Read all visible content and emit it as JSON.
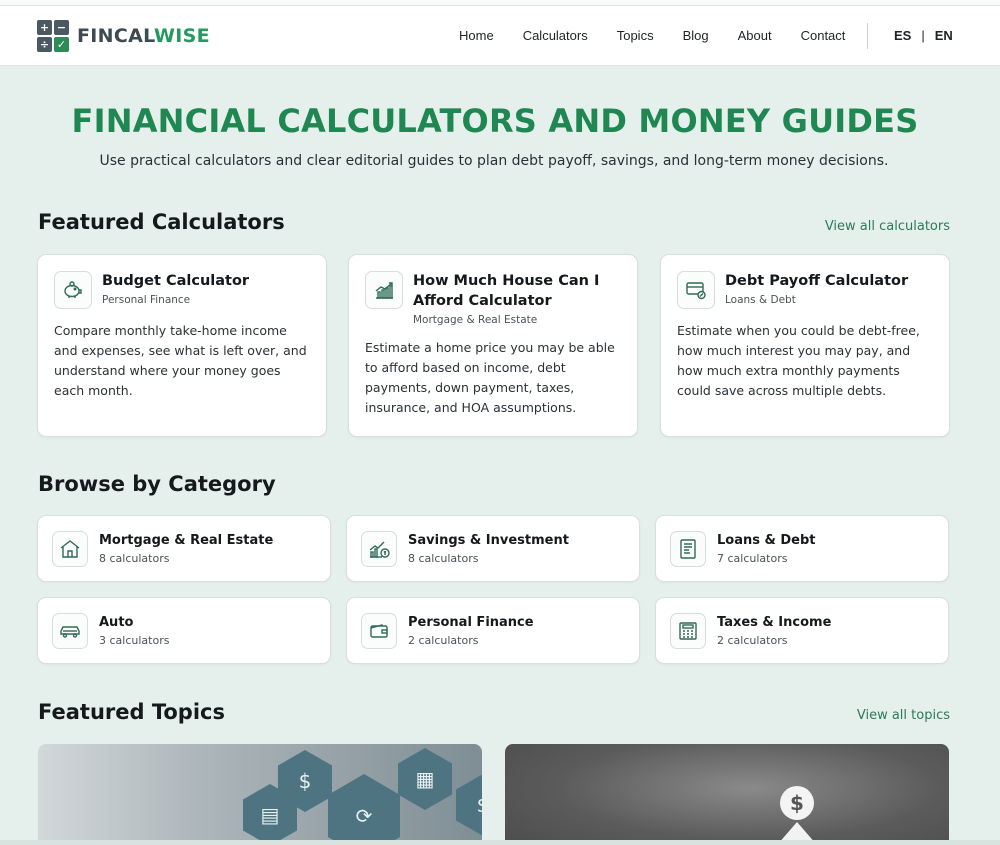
{
  "brand": {
    "part1": "FINCAL",
    "part2": "WISE",
    "accent": "#239a5f"
  },
  "nav": {
    "items": [
      "Home",
      "Calculators",
      "Topics",
      "Blog",
      "About"
    ],
    "contact": "Contact",
    "lang_es": "ES",
    "lang_sep": "|",
    "lang_en": "EN"
  },
  "hero": {
    "title": "FINANCIAL CALCULATORS AND MONEY GUIDES",
    "subtitle": "Use practical calculators and clear editorial guides to plan debt payoff, savings, and long-term money decisions."
  },
  "featured_calculators": {
    "heading": "Featured Calculators",
    "view_all": "View all calculators",
    "items": [
      {
        "title": "Budget Calculator",
        "category": "Personal Finance",
        "description": "Compare monthly take-home income and expenses, see what is left over, and understand where your money goes each month.",
        "icon": "piggy-bank-icon"
      },
      {
        "title": "How Much House Can I Afford Calculator",
        "category": "Mortgage & Real Estate",
        "description": "Estimate a home price you may be able to afford based on income, debt payments, down payment, taxes, insurance, and HOA assumptions.",
        "icon": "chart-growth-icon"
      },
      {
        "title": "Debt Payoff Calculator",
        "category": "Loans & Debt",
        "description": "Estimate when you could be debt-free, how much interest you may pay, and how much extra monthly payments could save across multiple debts.",
        "icon": "credit-card-icon"
      }
    ]
  },
  "categories": {
    "heading": "Browse by Category",
    "items": [
      {
        "title": "Mortgage & Real Estate",
        "count": "8 calculators",
        "icon": "house-icon"
      },
      {
        "title": "Savings & Investment",
        "count": "8 calculators",
        "icon": "savings-chart-icon"
      },
      {
        "title": "Loans & Debt",
        "count": "7 calculators",
        "icon": "document-icon"
      },
      {
        "title": "Auto",
        "count": "3 calculators",
        "icon": "car-icon"
      },
      {
        "title": "Personal Finance",
        "count": "2 calculators",
        "icon": "wallet-icon"
      },
      {
        "title": "Taxes & Income",
        "count": "2 calculators",
        "icon": "calculator-icon"
      }
    ]
  },
  "featured_topics": {
    "heading": "Featured Topics",
    "view_all": "View all topics"
  }
}
